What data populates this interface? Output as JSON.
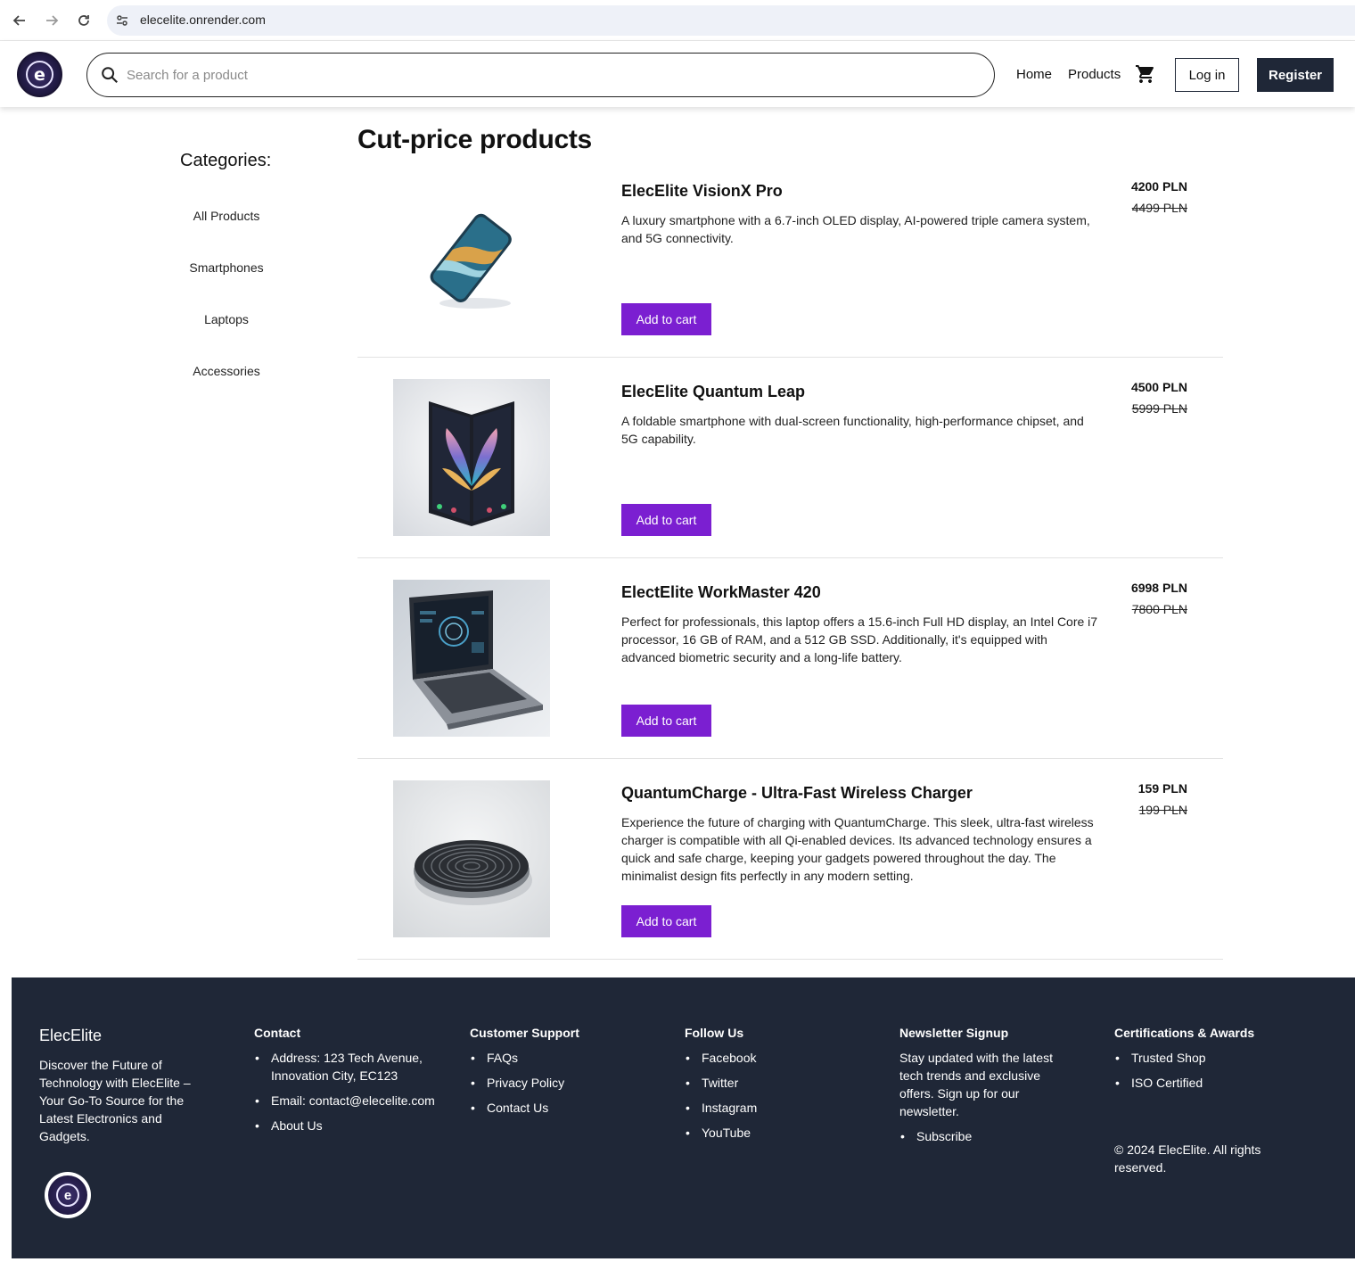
{
  "browser": {
    "url": "elecelite.onrender.com"
  },
  "header": {
    "search_placeholder": "Search for a product",
    "nav": [
      "Home",
      "Products"
    ],
    "login_label": "Log in",
    "register_label": "Register"
  },
  "sidebar": {
    "title": "Categories:",
    "items": [
      "All Products",
      "Smartphones",
      "Laptops",
      "Accessories"
    ]
  },
  "main": {
    "title": "Cut-price products",
    "products": [
      {
        "name": "ElecElite VisionX Pro",
        "description": "A luxury smartphone with a 6.7-inch OLED display, AI-powered triple camera system, and 5G connectivity.",
        "price": "4200 PLN",
        "old_price": "4499 PLN",
        "button": "Add to cart"
      },
      {
        "name": "ElecElite Quantum Leap",
        "description": "A foldable smartphone with dual-screen functionality, high-performance chipset, and 5G capability.",
        "price": "4500 PLN",
        "old_price": "5999 PLN",
        "button": "Add to cart"
      },
      {
        "name": "ElectElite WorkMaster 420",
        "description": "Perfect for professionals, this laptop offers a 15.6-inch Full HD display, an Intel Core i7 processor, 16 GB of RAM, and a 512 GB SSD. Additionally, it's equipped with advanced biometric security and a long-life battery.",
        "price": "6998 PLN",
        "old_price": "7800 PLN",
        "button": "Add to cart"
      },
      {
        "name": "QuantumCharge - Ultra-Fast Wireless Charger",
        "description": "Experience the future of charging with QuantumCharge. This sleek, ultra-fast wireless charger is compatible with all Qi-enabled devices. Its advanced technology ensures a quick and safe charge, keeping your gadgets powered throughout the day. The minimalist design fits perfectly in any modern setting.",
        "price": "159 PLN",
        "old_price": "199 PLN",
        "button": "Add to cart"
      }
    ]
  },
  "footer": {
    "brand": "ElecElite",
    "brand_desc": "Discover the Future of Technology with ElecElite – Your Go-To Source for the Latest Electronics and Gadgets.",
    "contact": {
      "title": "Contact",
      "items": [
        "Address: 123 Tech Avenue, Innovation City, EC123",
        "Email: contact@elecelite.com",
        "About Us"
      ]
    },
    "support": {
      "title": "Customer Support",
      "items": [
        "FAQs",
        "Privacy Policy",
        "Contact Us"
      ]
    },
    "follow": {
      "title": "Follow Us",
      "items": [
        "Facebook",
        "Twitter",
        "Instagram",
        "YouTube"
      ]
    },
    "newsletter": {
      "title": "Newsletter Signup",
      "text": "Stay updated with the latest tech trends and exclusive offers. Sign up for our newsletter.",
      "items": [
        "Subscribe"
      ]
    },
    "certs": {
      "title": "Certifications & Awards",
      "items": [
        "Trusted Shop",
        "ISO Certified"
      ]
    },
    "copyright": "© 2024 ElecElite. All rights reserved."
  },
  "colors": {
    "accent": "#7b1fd1",
    "dark": "#1f2737"
  }
}
